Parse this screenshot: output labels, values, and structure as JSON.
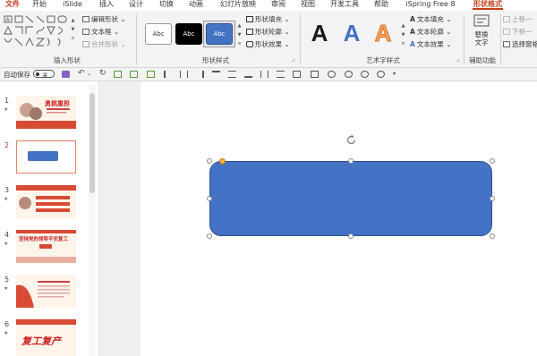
{
  "menu": {
    "items": [
      "文件",
      "开始",
      "iSlide",
      "插入",
      "设计",
      "切换",
      "动画",
      "幻灯片放映",
      "审阅",
      "视图",
      "开发工具",
      "帮助",
      "iSpring Free 8",
      "形状格式"
    ],
    "active": "形状格式"
  },
  "ribbon": {
    "insert_shapes": {
      "edit_shape": "编辑形状",
      "text_box": "文本框",
      "merge_shapes": "合并形状",
      "group_label": "插入形状"
    },
    "shape_styles": {
      "presets": [
        "Abc",
        "Abc",
        "Abc"
      ],
      "shape_fill": "形状填充",
      "shape_outline": "形状轮廓",
      "shape_effects": "形状效果",
      "group_label": "形状样式"
    },
    "wordart_styles": {
      "letters": [
        "A",
        "A",
        "A"
      ],
      "text_fill": "文本填充",
      "text_outline": "文本轮廓",
      "text_effects": "文本效果",
      "group_label": "艺术字样式"
    },
    "accessibility": {
      "alt_text_line1": "替换",
      "alt_text_line2": "文字",
      "group_label": "辅助功能"
    },
    "arrange": {
      "bring_forward": "上移一",
      "send_backward": "下移一",
      "selection_pane": "选择窗格"
    }
  },
  "qat": {
    "autosave_label": "自动保存",
    "toggle_state": "关"
  },
  "slides": {
    "numbers": [
      "1",
      "2",
      "3",
      "4",
      "5",
      "6"
    ],
    "selected": "2",
    "thumb_texts": {
      "s1": "勇挑重担",
      "s4": "坚持党的领导平安复工",
      "s6": "复工复产"
    }
  },
  "colors": {
    "accent": "#c43e1c",
    "shape_fill": "#4472c4",
    "ribbon_bg": "#f3f3f3",
    "canvas_bg": "#f0f0f0"
  }
}
